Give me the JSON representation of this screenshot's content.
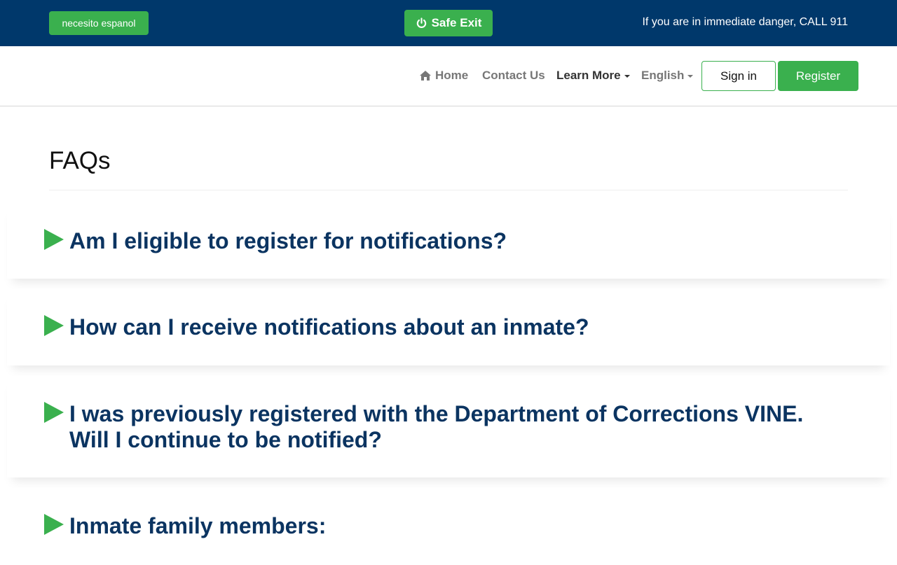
{
  "topbar": {
    "spanish_label": "necesito espanol",
    "safe_exit_label": "Safe Exit",
    "danger_text": "If you are in immediate danger, CALL 911"
  },
  "nav": {
    "home": "Home",
    "contact": "Contact Us",
    "learn_more": "Learn More",
    "language": "English",
    "sign_in": "Sign in",
    "register": "Register"
  },
  "page": {
    "title": "FAQs"
  },
  "faqs": [
    {
      "question": "Am I eligible to register for notifications?"
    },
    {
      "question": "How can I receive notifications about an inmate?"
    },
    {
      "question": "I was previously registered with the Department of Corrections VINE. Will I continue to be notified?"
    },
    {
      "question": "Inmate family members:"
    }
  ],
  "colors": {
    "topbar_bg": "#00386b",
    "accent_green": "#3ab04e",
    "question_text": "#0b3461"
  },
  "icons": {
    "safe_exit": "power-icon",
    "home": "home-icon",
    "faq_toggle": "triangle-right-icon"
  }
}
